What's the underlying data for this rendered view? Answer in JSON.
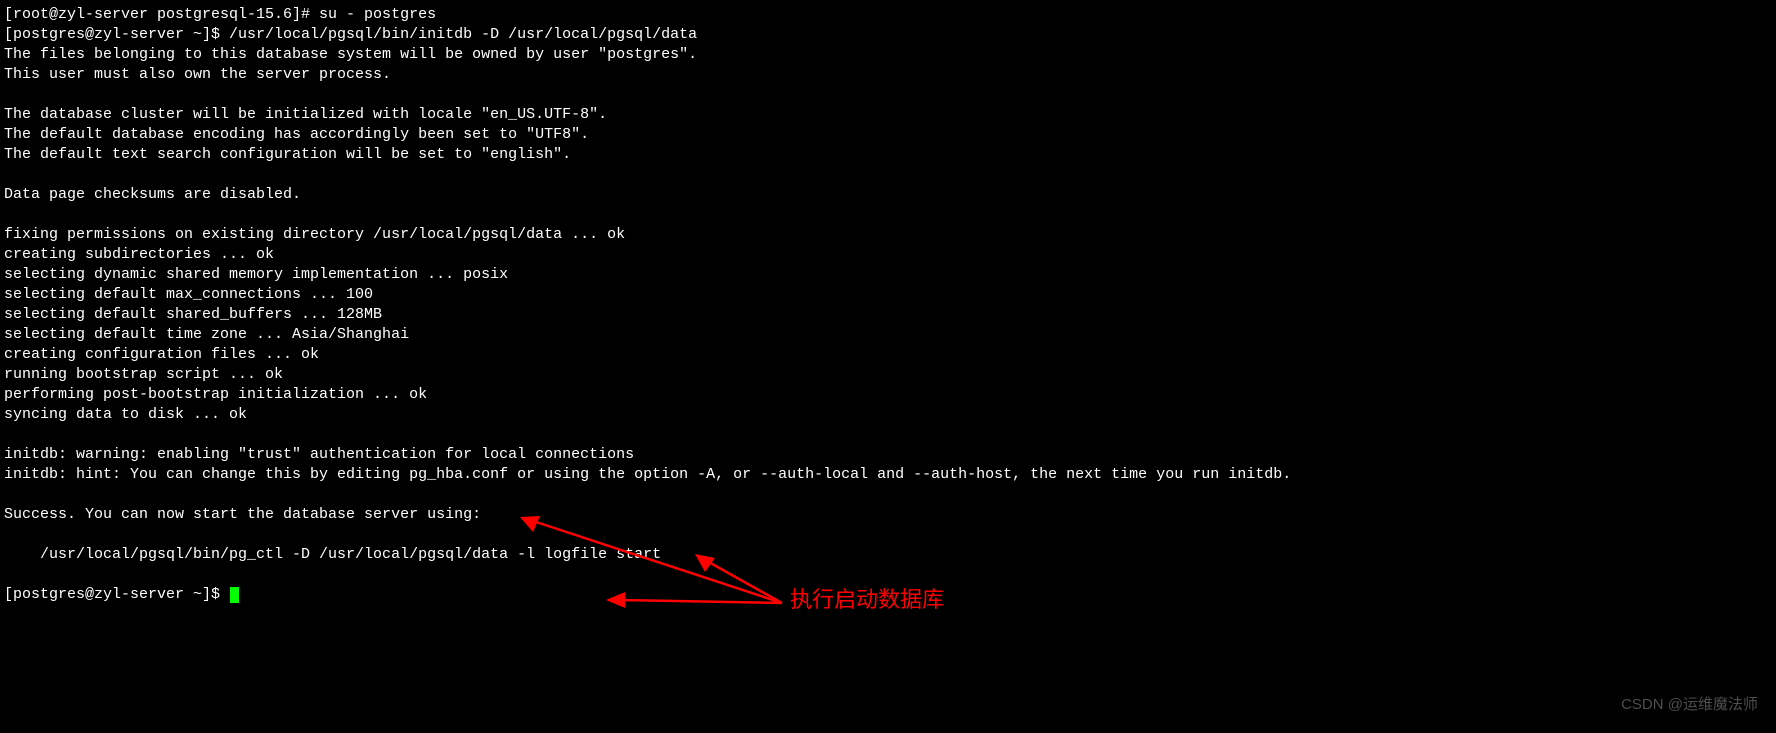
{
  "lines": [
    "[root@zyl-server postgresql-15.6]# su - postgres",
    "[postgres@zyl-server ~]$ /usr/local/pgsql/bin/initdb -D /usr/local/pgsql/data",
    "The files belonging to this database system will be owned by user \"postgres\".",
    "This user must also own the server process.",
    "",
    "The database cluster will be initialized with locale \"en_US.UTF-8\".",
    "The default database encoding has accordingly been set to \"UTF8\".",
    "The default text search configuration will be set to \"english\".",
    "",
    "Data page checksums are disabled.",
    "",
    "fixing permissions on existing directory /usr/local/pgsql/data ... ok",
    "creating subdirectories ... ok",
    "selecting dynamic shared memory implementation ... posix",
    "selecting default max_connections ... 100",
    "selecting default shared_buffers ... 128MB",
    "selecting default time zone ... Asia/Shanghai",
    "creating configuration files ... ok",
    "running bootstrap script ... ok",
    "performing post-bootstrap initialization ... ok",
    "syncing data to disk ... ok",
    "",
    "initdb: warning: enabling \"trust\" authentication for local connections",
    "initdb: hint: You can change this by editing pg_hba.conf or using the option -A, or --auth-local and --auth-host, the next time you run initdb.",
    "",
    "Success. You can now start the database server using:",
    "",
    "    /usr/local/pgsql/bin/pg_ctl -D /usr/local/pgsql/data -l logfile start",
    "",
    "[postgres@zyl-server ~]$ "
  ],
  "annotation": {
    "text": "执行启动数据库"
  },
  "watermark": "CSDN @运维魔法师"
}
